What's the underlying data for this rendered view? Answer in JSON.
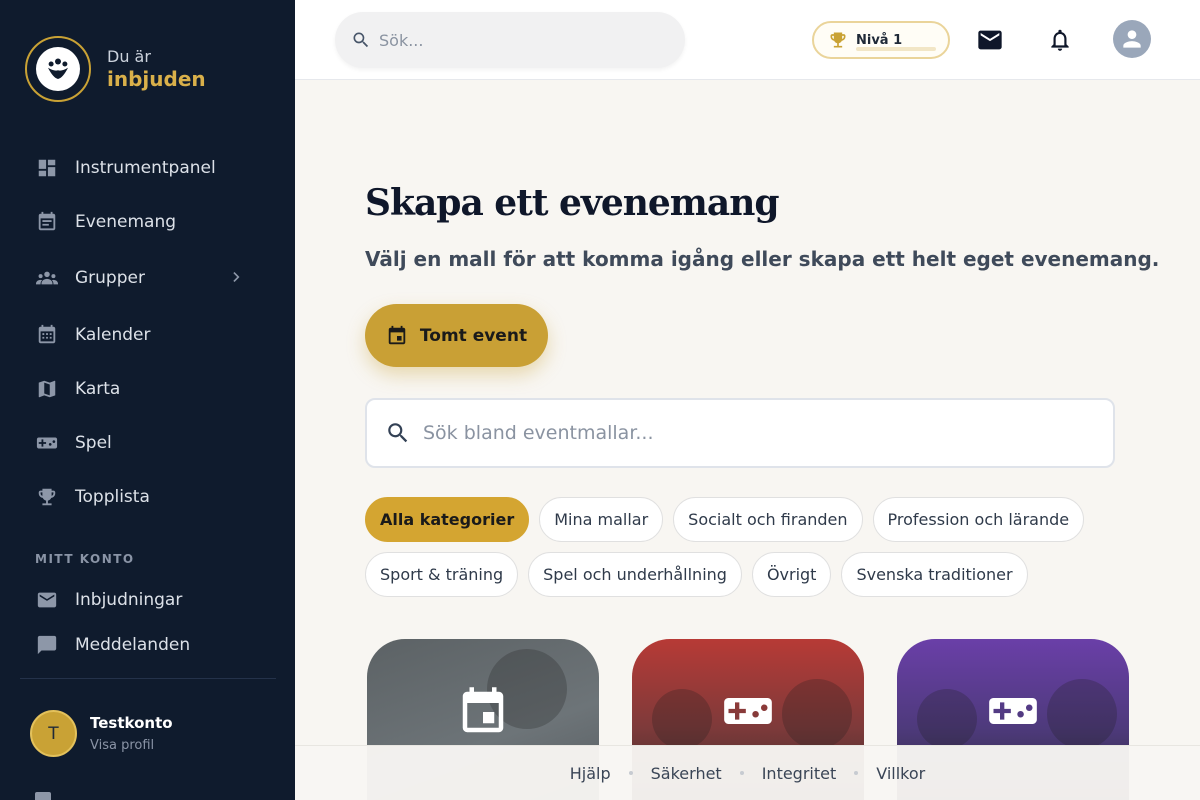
{
  "brand": {
    "line1": "Du är",
    "line2": "inbjuden"
  },
  "sidebar": {
    "items": [
      {
        "label": "Instrumentpanel",
        "icon": "dashboard-icon"
      },
      {
        "label": "Evenemang",
        "icon": "event-list-icon"
      },
      {
        "label": "Grupper",
        "icon": "groups-icon"
      },
      {
        "label": "Kalender",
        "icon": "calendar-icon"
      },
      {
        "label": "Karta",
        "icon": "map-icon"
      },
      {
        "label": "Spel",
        "icon": "gamepad-icon"
      },
      {
        "label": "Topplista",
        "icon": "trophy-icon"
      }
    ],
    "section_label": "MITT KONTO",
    "account_items": [
      {
        "label": "Inbjudningar",
        "icon": "mail-icon"
      },
      {
        "label": "Meddelanden",
        "icon": "chat-icon"
      }
    ],
    "profile": {
      "initial": "T",
      "name": "Testkonto",
      "link": "Visa profil"
    }
  },
  "topbar": {
    "search_placeholder": "Sök...",
    "level_label": "Nivå 1",
    "level_progress": 0
  },
  "main": {
    "title": "Skapa ett evenemang",
    "subtitle": "Välj en mall för att komma igång eller skapa ett helt eget evenemang.",
    "empty_button": "Tomt event",
    "template_search_placeholder": "Sök bland eventmallar...",
    "categories_row1": [
      "Alla kategorier",
      "Mina mallar",
      "Socialt och firanden",
      "Profession och lärande"
    ],
    "categories_row2": [
      "Sport & träning",
      "Spel och underhållning",
      "Övrigt",
      "Svenska traditioner"
    ],
    "active_category": "Alla kategorier"
  },
  "footer": {
    "links": [
      "Hjälp",
      "Säkerhet",
      "Integritet",
      "Villkor"
    ]
  },
  "colors": {
    "sidebar_bg": "#0f1b2d",
    "accent": "#c9a035",
    "page_bg": "#f8f6f2"
  }
}
